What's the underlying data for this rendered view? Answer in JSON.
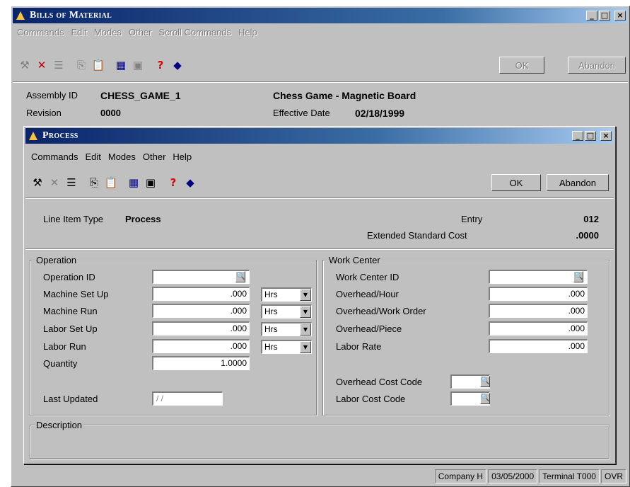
{
  "main_window": {
    "title": "Bills of Material",
    "menu": [
      "Commands",
      "Edit",
      "Modes",
      "Other",
      "Scroll Commands",
      "Help"
    ],
    "ok_label": "OK",
    "abandon_label": "Abandon",
    "assembly_id_label": "Assembly ID",
    "assembly_id_value": "CHESS_GAME_1",
    "assembly_desc": "Chess Game - Magnetic Board",
    "revision_label": "Revision",
    "revision_value": "0000",
    "effective_date_label": "Effective Date",
    "effective_date_value": "02/18/1999"
  },
  "toolbar_icons": [
    "hammer-icon",
    "delete-icon",
    "list-icon",
    "copy-icon",
    "paste-icon",
    "calculator-icon",
    "calendar-icon",
    "help-icon",
    "book-icon"
  ],
  "dialog": {
    "title": "Process",
    "menu": [
      "Commands",
      "Edit",
      "Modes",
      "Other",
      "Help"
    ],
    "ok_label": "OK",
    "abandon_label": "Abandon",
    "line_item_type_label": "Line Item Type",
    "line_item_type_value": "Process",
    "entry_label": "Entry",
    "entry_value": "012",
    "ext_std_cost_label": "Extended Standard Cost",
    "ext_std_cost_value": ".0000",
    "operation": {
      "title": "Operation",
      "operation_id_label": "Operation ID",
      "operation_id_value": "",
      "machine_setup_label": "Machine Set Up",
      "machine_setup_value": ".000",
      "machine_setup_unit": "Hrs",
      "machine_run_label": "Machine Run",
      "machine_run_value": ".000",
      "machine_run_unit": "Hrs",
      "labor_setup_label": "Labor Set Up",
      "labor_setup_value": ".000",
      "labor_setup_unit": "Hrs",
      "labor_run_label": "Labor Run",
      "labor_run_value": ".000",
      "labor_run_unit": "Hrs",
      "quantity_label": "Quantity",
      "quantity_value": "1.0000",
      "last_updated_label": "Last Updated",
      "last_updated_value": "/ /"
    },
    "work_center": {
      "title": "Work Center",
      "work_center_id_label": "Work Center ID",
      "work_center_id_value": "",
      "overhead_hour_label": "Overhead/Hour",
      "overhead_hour_value": ".000",
      "overhead_wo_label": "Overhead/Work Order",
      "overhead_wo_value": ".000",
      "overhead_piece_label": "Overhead/Piece",
      "overhead_piece_value": ".000",
      "labor_rate_label": "Labor Rate",
      "labor_rate_value": ".000",
      "overhead_cost_code_label": "Overhead Cost Code",
      "labor_cost_code_label": "Labor Cost Code"
    },
    "description_label": "Description"
  },
  "status_bar": {
    "company": "Company H",
    "date": "03/05/2000",
    "terminal": "Terminal T000",
    "mode": "OVR"
  }
}
